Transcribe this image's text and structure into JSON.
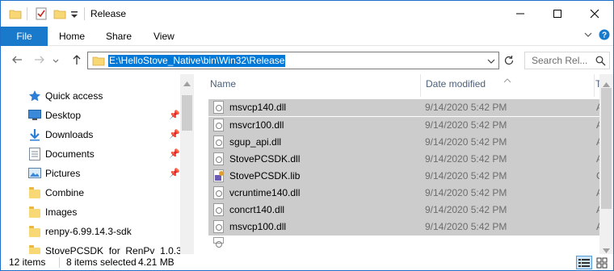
{
  "window": {
    "title": "Release"
  },
  "ribbon": {
    "file_label": "File",
    "tabs": [
      "Home",
      "Share",
      "View"
    ]
  },
  "address": {
    "path": "E:\\HelloStove_Native\\bin\\Win32\\Release",
    "search_placeholder": "Search Rel..."
  },
  "nav": {
    "items": [
      {
        "label": "Quick access",
        "icon": "star-icon",
        "pinned": false
      },
      {
        "label": "Desktop",
        "icon": "desktop-icon",
        "pinned": true
      },
      {
        "label": "Downloads",
        "icon": "download-icon",
        "pinned": true
      },
      {
        "label": "Documents",
        "icon": "documents-icon",
        "pinned": true
      },
      {
        "label": "Pictures",
        "icon": "pictures-icon",
        "pinned": true
      },
      {
        "label": "Combine",
        "icon": "folder-icon",
        "pinned": false
      },
      {
        "label": "Images",
        "icon": "folder-icon",
        "pinned": false
      },
      {
        "label": "renpy-6.99.14.3-sdk",
        "icon": "folder-icon",
        "pinned": false
      },
      {
        "label": "StovePCSDK_for_RenPy_1.0.3",
        "icon": "folder-icon",
        "pinned": false
      }
    ]
  },
  "columns": {
    "name": "Name",
    "date": "Date modified",
    "type_partial": "T"
  },
  "files": [
    {
      "name": "msvcp140.dll",
      "date": "9/14/2020 5:42 PM",
      "type_partial": "A"
    },
    {
      "name": "msvcr100.dll",
      "date": "9/14/2020 5:42 PM",
      "type_partial": "A"
    },
    {
      "name": "sgup_api.dll",
      "date": "9/14/2020 5:42 PM",
      "type_partial": "A"
    },
    {
      "name": "StovePCSDK.dll",
      "date": "9/14/2020 5:42 PM",
      "type_partial": "A"
    },
    {
      "name": "StovePCSDK.lib",
      "date": "9/14/2020 5:42 PM",
      "type_partial": "C"
    },
    {
      "name": "vcruntime140.dll",
      "date": "9/14/2020 5:42 PM",
      "type_partial": "A"
    },
    {
      "name": "concrt140.dll",
      "date": "9/14/2020 5:42 PM",
      "type_partial": "A"
    },
    {
      "name": "msvcp100.dll",
      "date": "9/14/2020 5:42 PM",
      "type_partial": "A"
    }
  ],
  "status": {
    "item_count": "12 items",
    "selected": "8 items selected",
    "size": "4.21 MB"
  },
  "colors": {
    "accent": "#1979ca",
    "selection": "#cccccc",
    "address_highlight": "#0078d7"
  }
}
